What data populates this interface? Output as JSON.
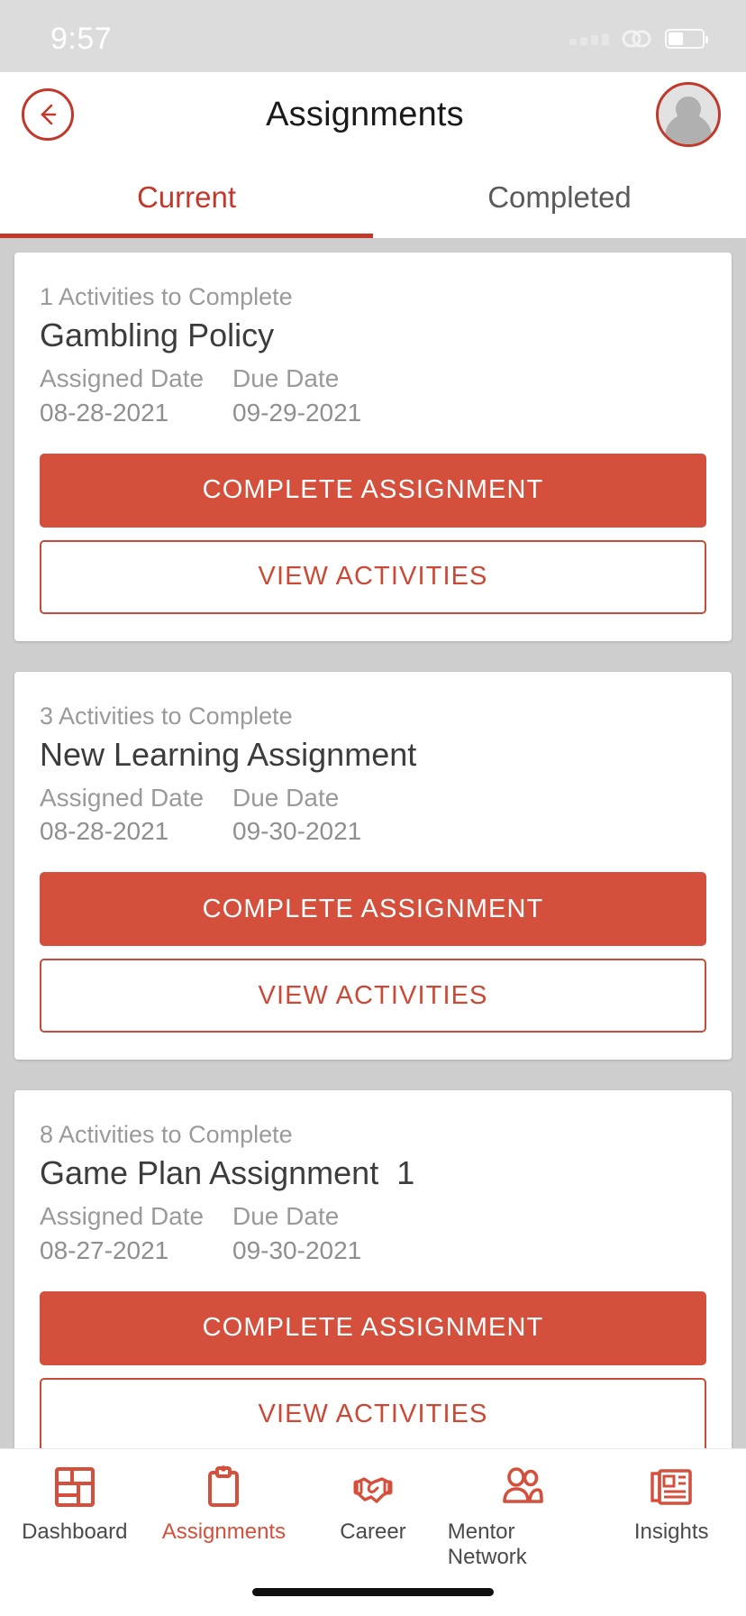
{
  "status_bar": {
    "time": "9:57",
    "signal_icon": "signal-dots-icon",
    "link_icon": "link-circles-icon",
    "battery_icon": "battery-icon"
  },
  "header": {
    "back_icon": "back-arrow-icon",
    "title": "Assignments",
    "avatar_icon": "avatar-person-icon"
  },
  "tabs": [
    {
      "label": "Current",
      "active": true
    },
    {
      "label": "Completed",
      "active": false
    }
  ],
  "labels": {
    "assigned_date": "Assigned Date",
    "due_date": "Due Date",
    "complete_assignment": "COMPLETE ASSIGNMENT",
    "view_activities": "VIEW ACTIVITIES"
  },
  "cards": [
    {
      "count_text": "1 Activities to Complete",
      "title": "Gambling Policy",
      "assigned_date": "08-28-2021",
      "due_date": "09-29-2021"
    },
    {
      "count_text": "3 Activities to Complete",
      "title": "New Learning Assignment",
      "assigned_date": "08-28-2021",
      "due_date": "09-30-2021"
    },
    {
      "count_text": "8 Activities to Complete",
      "title": "Game Plan Assignment  1",
      "assigned_date": "08-27-2021",
      "due_date": "09-30-2021"
    }
  ],
  "bottom_nav": [
    {
      "label": "Dashboard",
      "icon": "dashboard-grid-icon",
      "active": false
    },
    {
      "label": "Assignments",
      "icon": "clipboard-icon",
      "active": true
    },
    {
      "label": "Career",
      "icon": "handshake-icon",
      "active": false
    },
    {
      "label": "Mentor Network",
      "icon": "people-icon",
      "active": false
    },
    {
      "label": "Insights",
      "icon": "newspaper-icon",
      "active": false
    }
  ],
  "colors": {
    "accent": "#c0392b",
    "button_fill": "#d4503c",
    "background": "#cfcfcf",
    "status_bar": "#dcdcdc"
  }
}
